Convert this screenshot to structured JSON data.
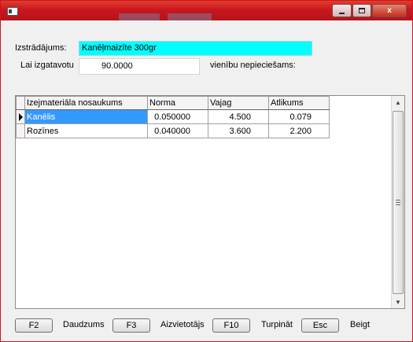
{
  "window": {
    "close_glyph": "x"
  },
  "form": {
    "product_label": "Izstrādājums:",
    "product_value": "Kanēļmaizīte 300gr",
    "qty_label": "Lai izgatavotu",
    "qty_value": "90.0000",
    "units_label": "vienību nepieciešams:"
  },
  "grid": {
    "columns": [
      "Izejmateriāla nosaukums",
      "Norma",
      "Vajag",
      "Atlikums"
    ],
    "rows": [
      {
        "name": "Kanēlis",
        "norma": "0.050000",
        "vajag": "4.500",
        "atlikums": "0.079"
      },
      {
        "name": "Rozīnes",
        "norma": "0.040000",
        "vajag": "3.600",
        "atlikums": "2.200"
      }
    ]
  },
  "footer": [
    {
      "key": "F2",
      "label": "Daudzums"
    },
    {
      "key": "F3",
      "label": "Aizvietotājs"
    },
    {
      "key": "F10",
      "label": "Turpināt"
    },
    {
      "key": "Esc",
      "label": "Beigt"
    }
  ]
}
